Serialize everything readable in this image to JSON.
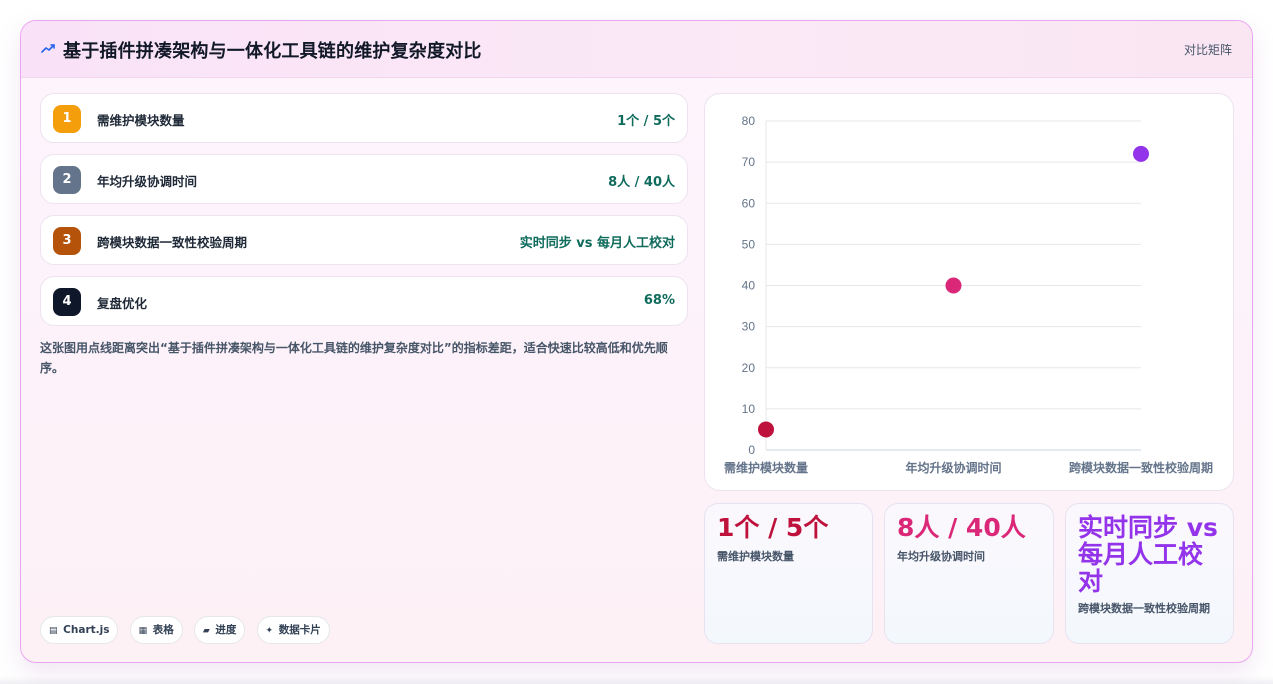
{
  "header": {
    "title": "基于插件拼凑架构与一体化工具链的维护复杂度对比",
    "tag": "对比矩阵",
    "icon": "chart-trend-icon"
  },
  "metrics": [
    {
      "index": "1",
      "label": "需维护模块数量",
      "value": "1个 / 5个",
      "color": "#f59e0b"
    },
    {
      "index": "2",
      "label": "年均升级协调时间",
      "value": "8人 / 40人",
      "color": "#64748b"
    },
    {
      "index": "3",
      "label": "跨模块数据一致性校验周期",
      "value": "实时同步 vs 每月人工校对",
      "color": "#b45309"
    },
    {
      "index": "4",
      "label": "复盘优化",
      "value": "68%",
      "color": "#0f172a"
    }
  ],
  "description": "这张图用点线距离突出“基于插件拼凑架构与一体化工具链的维护复杂度对比”的指标差距，适合快速比较高低和优先顺序。",
  "chips": [
    {
      "icon": "▤",
      "label": "Chart.js"
    },
    {
      "icon": "▦",
      "label": "表格"
    },
    {
      "icon": "▰",
      "label": "进度"
    },
    {
      "icon": "✦",
      "label": "数据卡片"
    }
  ],
  "chart_data": {
    "type": "scatter",
    "categories": [
      "需维护模块数量",
      "年均升级协调时间",
      "跨模块数据一致性校验周期"
    ],
    "values": [
      5,
      40,
      72
    ],
    "point_colors": [
      "#be123c",
      "#db2777",
      "#9333ea"
    ],
    "ylim": [
      0,
      80
    ],
    "yticks": [
      0,
      10,
      20,
      30,
      40,
      50,
      60,
      70,
      80
    ],
    "grid": true,
    "legend": "none"
  },
  "stats": [
    {
      "value": "1个 / 5个",
      "label": "需维护模块数量",
      "color": "#be123c"
    },
    {
      "value": "8人 / 40人",
      "label": "年均升级协调时间",
      "color": "#db2777"
    },
    {
      "value": "实时同步 vs 每月人工校对",
      "label": "跨模块数据一致性校验周期",
      "color": "#9333ea"
    }
  ]
}
